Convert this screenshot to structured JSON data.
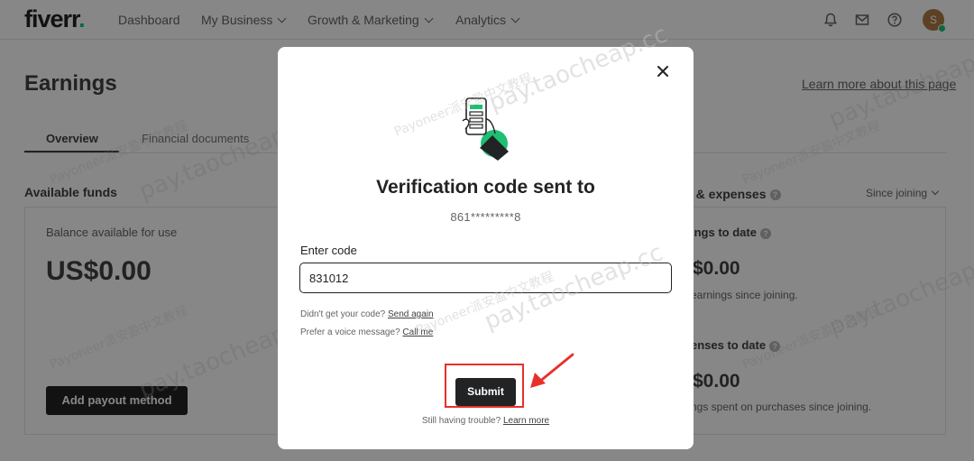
{
  "header": {
    "logo": "fiverr",
    "logo_dot": ".",
    "nav": [
      {
        "label": "Dashboard",
        "has_dropdown": false
      },
      {
        "label": "My Business",
        "has_dropdown": true
      },
      {
        "label": "Growth & Marketing",
        "has_dropdown": true
      },
      {
        "label": "Analytics",
        "has_dropdown": true
      }
    ],
    "icons": [
      "bell-icon",
      "mail-icon",
      "help-icon"
    ],
    "avatar_initial": "S",
    "accent_color": "#1dbf73"
  },
  "page": {
    "title": "Earnings",
    "learn_link": "Learn more about this page",
    "tabs": [
      {
        "label": "Overview",
        "active": true
      },
      {
        "label": "Financial documents",
        "active": false
      }
    ],
    "available_funds": {
      "title": "Available funds",
      "balance_label": "Balance available for use",
      "balance_amount": "US$0.00",
      "payout_button": "Add payout method"
    },
    "earnings": {
      "title_partial": "s & expenses",
      "filter": "Since joining",
      "earnings_label": "ings to date",
      "earnings_amount": "$0.00",
      "earnings_sub": "earnings since joining.",
      "expenses_label": "enses to date",
      "expenses_amount": "$0.00",
      "expenses_sub": "ngs spent on purchases since joining."
    }
  },
  "modal": {
    "title": "Verification code sent to",
    "phone": "861*********8",
    "input_label": "Enter code",
    "input_value": "831012",
    "no_code_text": "Didn't get your code?",
    "send_again": "Send again",
    "voice_text": "Prefer a voice message?",
    "call_me": "Call me",
    "submit": "Submit",
    "trouble_text": "Still having trouble?",
    "learn_more": "Learn more",
    "highlight_color": "#e8302a"
  },
  "watermark": {
    "text_small": "Payoneer派安盈中文教程",
    "text_big": "pay.taocheap.cc"
  }
}
